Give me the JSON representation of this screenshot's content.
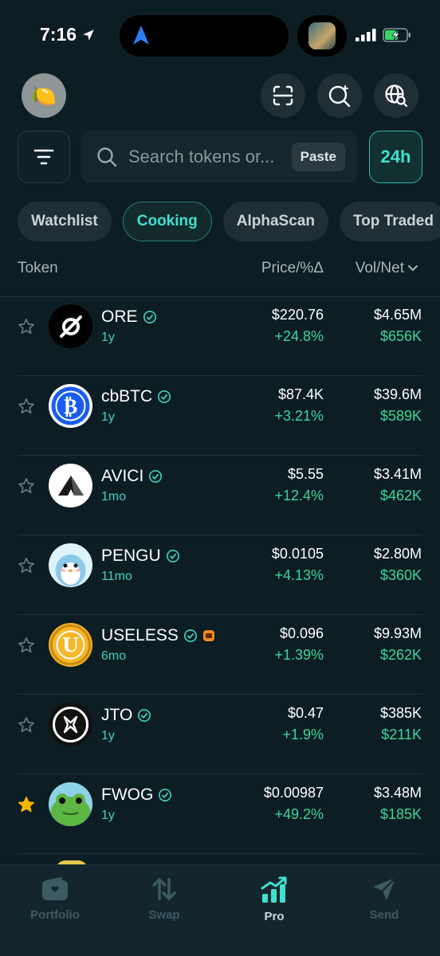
{
  "status_bar": {
    "time": "7:16"
  },
  "header": {
    "avatar_emoji": "🍋"
  },
  "search": {
    "placeholder": "Search tokens or...",
    "paste_label": "Paste",
    "time_filter": "24h"
  },
  "tabs": [
    {
      "label": "Watchlist",
      "active": false
    },
    {
      "label": "Cooking",
      "active": true
    },
    {
      "label": "AlphaScan",
      "active": false
    },
    {
      "label": "Top Traded",
      "active": false
    }
  ],
  "columns": {
    "token": "Token",
    "price": "Price/%Δ",
    "vol": "Vol/Net"
  },
  "tokens": [
    {
      "name": "ORE",
      "age": "1y",
      "price": "$220.76",
      "change": "+24.8%",
      "vol": "$4.65M",
      "net": "$656K",
      "starred": false,
      "icon": "ore-logo"
    },
    {
      "name": "cbBTC",
      "age": "1y",
      "price": "$87.4K",
      "change": "+3.21%",
      "vol": "$39.6M",
      "net": "$589K",
      "starred": false,
      "icon": "bitcoin-logo"
    },
    {
      "name": "AVICI",
      "age": "1mo",
      "price": "$5.55",
      "change": "+12.4%",
      "vol": "$3.41M",
      "net": "$462K",
      "starred": false,
      "icon": "avici-logo"
    },
    {
      "name": "PENGU",
      "age": "11mo",
      "price": "$0.0105",
      "change": "+4.13%",
      "vol": "$2.80M",
      "net": "$360K",
      "starred": false,
      "icon": "penguin-logo"
    },
    {
      "name": "USELESS",
      "age": "6mo",
      "price": "$0.096",
      "change": "+1.39%",
      "vol": "$9.93M",
      "net": "$262K",
      "starred": false,
      "icon": "useless-coin-logo"
    },
    {
      "name": "JTO",
      "age": "1y",
      "price": "$0.47",
      "change": "+1.9%",
      "vol": "$385K",
      "net": "$211K",
      "starred": false,
      "icon": "jito-logo"
    },
    {
      "name": "FWOG",
      "age": "1y",
      "price": "$0.00987",
      "change": "+49.2%",
      "vol": "$3.48M",
      "net": "$185K",
      "starred": true,
      "icon": "frog-logo"
    }
  ],
  "bottom_nav": [
    {
      "label": "Portfolio",
      "active": false
    },
    {
      "label": "Swap",
      "active": false
    },
    {
      "label": "Pro",
      "active": true
    },
    {
      "label": "Send",
      "active": false
    }
  ],
  "colors": {
    "accent": "#3fe0cf",
    "positive": "#3dd69a",
    "background": "#0d1d24",
    "star_active": "#f5b800"
  }
}
